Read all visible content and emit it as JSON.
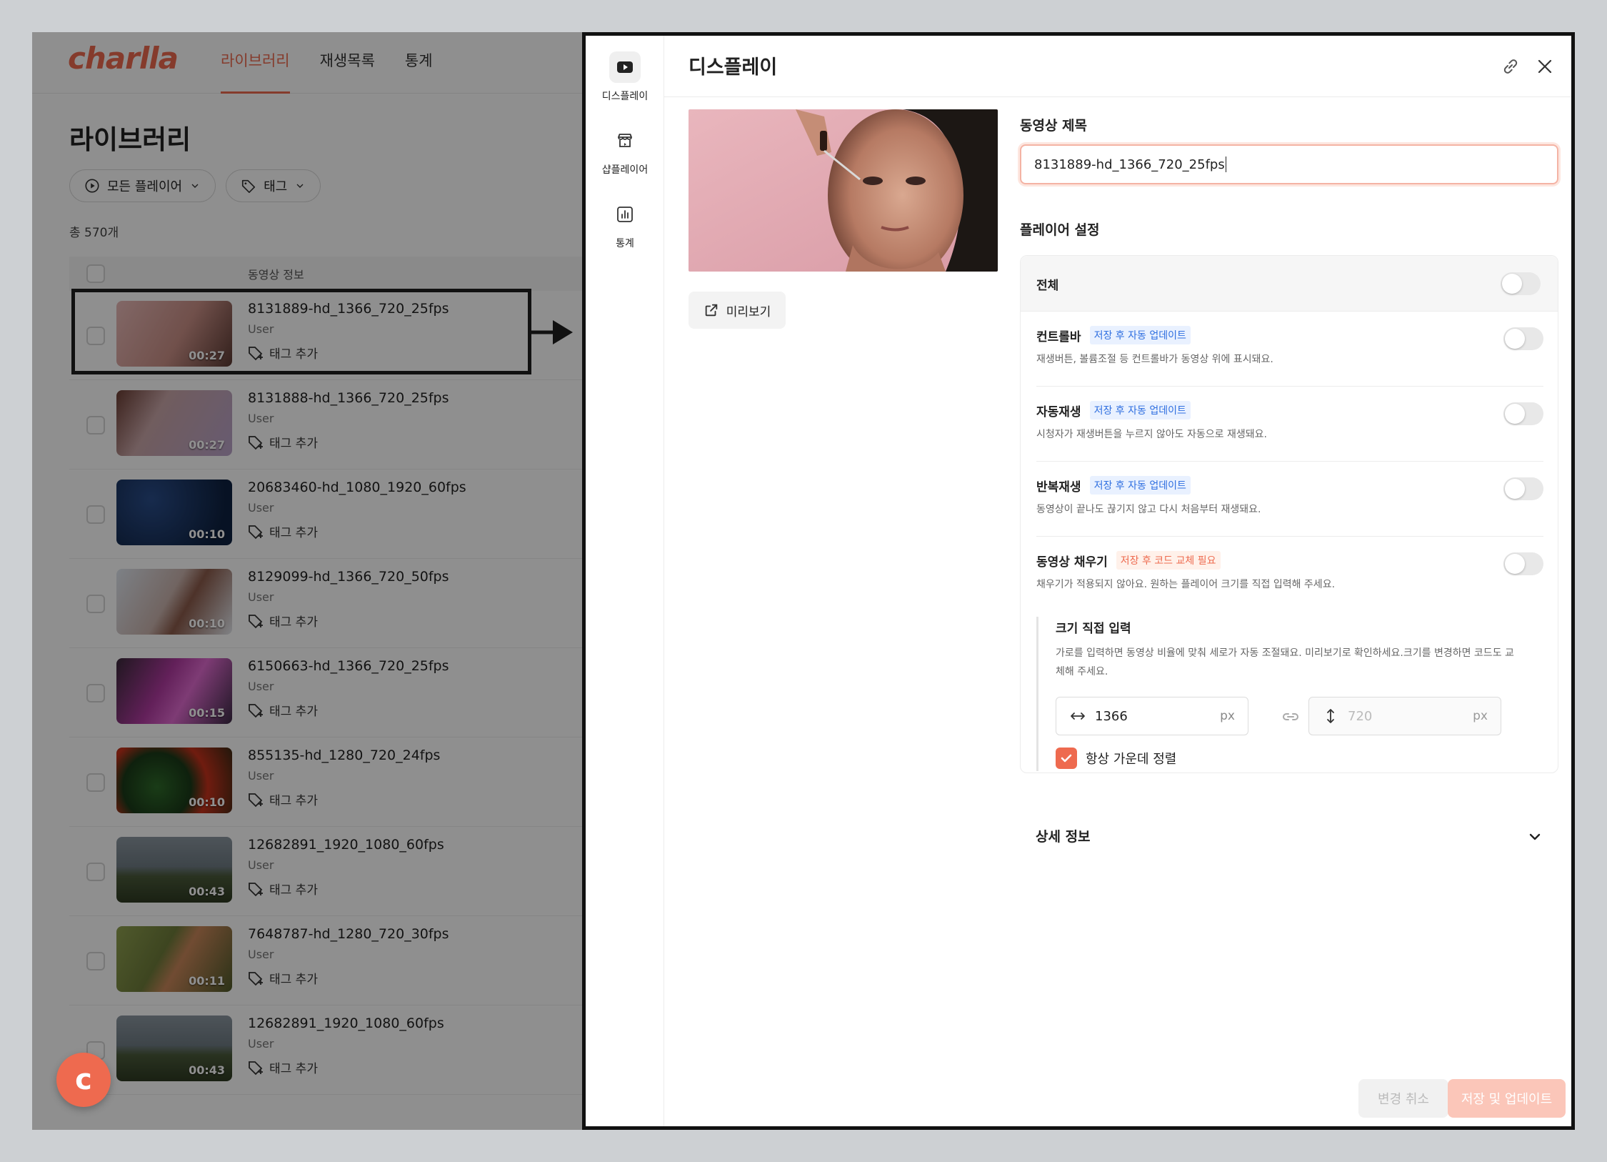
{
  "app": {
    "logo": "charlla",
    "nav": [
      "라이브러리",
      "재생목록",
      "통계"
    ],
    "library_title": "라이브러리",
    "filters": {
      "player": "모든 플레이어",
      "tag": "태그"
    },
    "total": "총 570개",
    "column_header": "동영상 정보",
    "tag_add_label": "태그 추가",
    "fab_label": "c",
    "videos": [
      {
        "title": "8131889-hd_1366_720_25fps",
        "user": "User",
        "duration": "00:27"
      },
      {
        "title": "8131888-hd_1366_720_25fps",
        "user": "User",
        "duration": "00:27"
      },
      {
        "title": "20683460-hd_1080_1920_60fps",
        "user": "User",
        "duration": "00:10"
      },
      {
        "title": "8129099-hd_1366_720_50fps",
        "user": "User",
        "duration": "00:10"
      },
      {
        "title": "6150663-hd_1366_720_25fps",
        "user": "User",
        "duration": "00:15"
      },
      {
        "title": "855135-hd_1280_720_24fps",
        "user": "User",
        "duration": "00:10"
      },
      {
        "title": "12682891_1920_1080_60fps",
        "user": "User",
        "duration": "00:43"
      },
      {
        "title": "7648787-hd_1280_720_30fps",
        "user": "User",
        "duration": "00:11"
      },
      {
        "title": "12682891_1920_1080_60fps",
        "user": "User",
        "duration": "00:43"
      }
    ]
  },
  "panel": {
    "sidebar": [
      {
        "label": "디스플레이",
        "icon": "play-icon"
      },
      {
        "label": "샵플레이어",
        "icon": "store-icon"
      },
      {
        "label": "통계",
        "icon": "chart-icon"
      }
    ],
    "title": "디스플레이",
    "preview_button": "미리보기",
    "video_title_label": "동영상 제목",
    "video_title_value": "8131889-hd_1366_720_25fps",
    "player_settings_label": "플레이어 설정",
    "all_label": "전체",
    "settings": [
      {
        "name": "컨트롤바",
        "badge": "저장 후 자동 업데이트",
        "desc": "재생버튼, 볼륨조절 등 컨트롤바가 동영상 위에 표시돼요."
      },
      {
        "name": "자동재생",
        "badge": "저장 후 자동 업데이트",
        "desc": "시청자가 재생버튼을 누르지 않아도 자동으로 재생돼요."
      },
      {
        "name": "반복재생",
        "badge": "저장 후 자동 업데이트",
        "desc": "동영상이 끝나도 끊기지 않고 다시 처음부터 재생돼요."
      },
      {
        "name": "동영상 채우기",
        "badge": "저장 후 코드 교체 필요",
        "desc": "채우기가 적용되지 않아요. 원하는 플레이어 크기를 직접 입력해 주세요."
      }
    ],
    "manual": {
      "title": "크기 직접 입력",
      "desc": "가로를 입력하면 동영상 비율에 맞춰 세로가 자동 조절돼요. 미리보기로 확인하세요.크기를 변경하면 코드도 교체해 주세요.",
      "width": "1366",
      "height": "720",
      "unit": "px",
      "center_label": "항상 가운데 정렬"
    },
    "details_label": "상세 정보",
    "cancel_button": "변경 취소",
    "save_button": "저장 및 업데이트"
  },
  "colors": {
    "accent": "#ee6a4f",
    "badge_blue": "#2f6fe0",
    "save_disabled": "#fbc6b9"
  }
}
